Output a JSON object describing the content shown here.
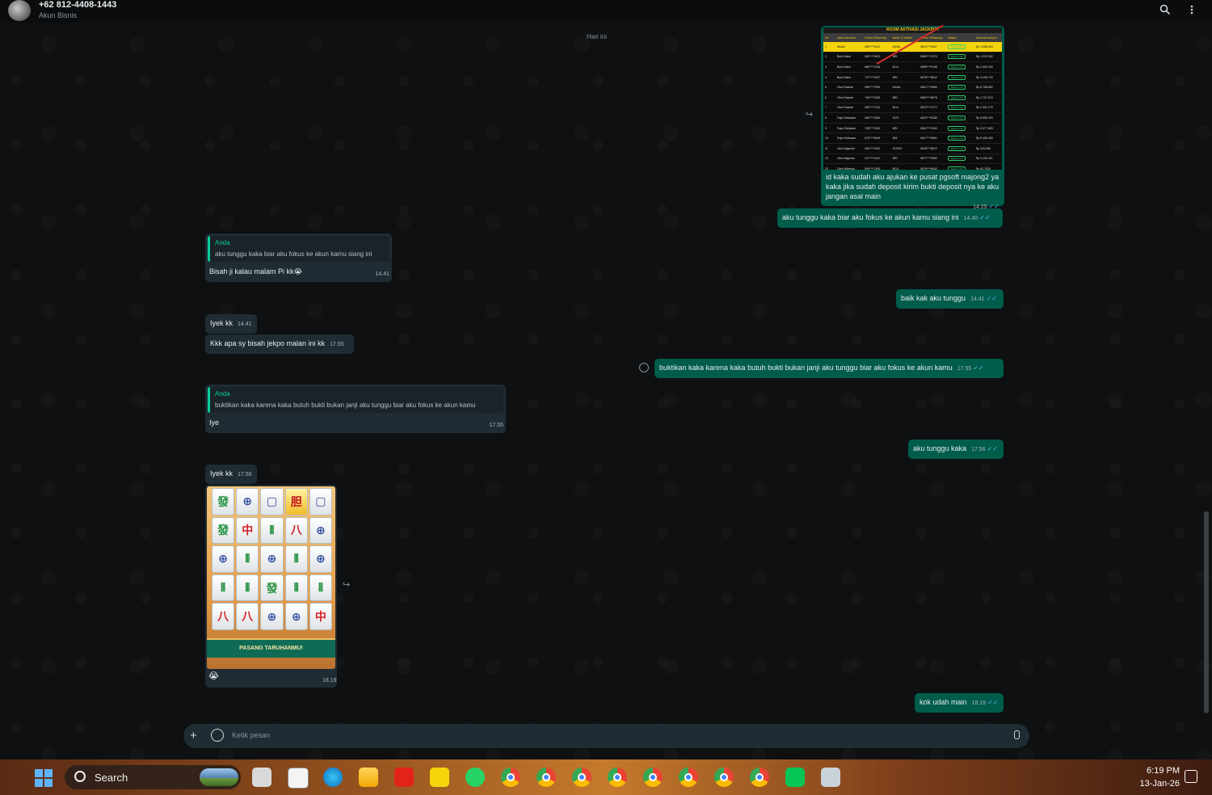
{
  "header": {
    "contact_name": "+62 812-4408-1443",
    "contact_sub": "Akun Bisnis",
    "icons": [
      "search-icon",
      "more-vert-icon"
    ]
  },
  "chat": {
    "day_label": "Hari ini",
    "messages": [
      {
        "id": "m1",
        "side": "out",
        "text": "id kaka sudah aku ajukan ke pusat pgsoft majong2 ya kaka jika sudah deposit kirim bukti deposit nya ke aku jangan asal main",
        "time": "14.25"
      },
      {
        "id": "m2",
        "side": "out",
        "text": "aku tunggu kaka biar aku fokus ke akun kamu siang ini",
        "time": "14.40"
      },
      {
        "id": "m3",
        "side": "in",
        "quote_author": "Anda",
        "quote_text": "aku tunggu kaka biar aku fokus ke akun kamu siang ini",
        "text": "Bisah ji kalau malam Pi kk😭",
        "time": "14.41"
      },
      {
        "id": "m4",
        "side": "out",
        "text": "baik kak aku tunggu",
        "time": "14.41"
      },
      {
        "id": "m5",
        "side": "in",
        "text": "Iyek kk",
        "time": "14.41"
      },
      {
        "id": "m6",
        "side": "in",
        "text": "Kkk apa sy bisah jekpo malan ini kk",
        "time": "17.55"
      },
      {
        "id": "m7",
        "side": "out",
        "text": "buktikan kaka karena kaka butuh bukti bukan janji aku tunggu biar aku fokus ke akun kamu",
        "time": "17.55"
      },
      {
        "id": "m8",
        "side": "in",
        "quote_author": "Anda",
        "quote_text": "buktikan kaka karena kaka butuh bukti bukan janji aku tunggu biar aku fokus ke akun kamu",
        "text": "Iye",
        "time": "17.55"
      },
      {
        "id": "m9",
        "side": "out",
        "text": "aku tunggu kaka",
        "time": "17.56"
      },
      {
        "id": "m10",
        "side": "in",
        "text": "Iyek kk",
        "time": "17.56"
      },
      {
        "id": "m11",
        "side": "in",
        "text": "😭",
        "time": "18.19",
        "image_caption": "PASANG TARUHANMU!"
      },
      {
        "id": "m12",
        "side": "out",
        "text": "kok udah main",
        "time": "18.19"
      }
    ],
    "ticks_glyph": "✓✓",
    "forward_glyph": "↪"
  },
  "table_image": {
    "title": "ROOM AKTIVASI JACKPOT",
    "headers": [
      "No",
      "Nama Member",
      "Nomor Rekening",
      "Bank / E-Wallet",
      "Nomor WhatsApp",
      "Status",
      "Nominal Jackpot"
    ],
    "rows": [
      [
        "1",
        "Wulan",
        "056****4412",
        "DANA",
        "0813****5447",
        "Jackpot OK",
        "Rp 1.058.000"
      ],
      [
        "2",
        "Budi Halim",
        "082****0521",
        "BRI",
        "0853****2270",
        "Jackpot OK",
        "Rp 1.222.352"
      ],
      [
        "3",
        "Budi Halim",
        "689****2136",
        "BCA",
        "0856****9198",
        "Jackpot OK",
        "Rp 2.095.049"
      ],
      [
        "4",
        "Budi Halim",
        "727****3227",
        "BRI",
        "0878****8812",
        "Jackpot OK",
        "Rp 3.208.722"
      ],
      [
        "5",
        "Citra Rasmie",
        "059****7992",
        "DANA",
        "0821****5080",
        "Jackpot OK",
        "Rp 8.758.892"
      ],
      [
        "6",
        "Citra Rasmie",
        "740****2152",
        "BRI",
        "0852****8978",
        "Jackpot OK",
        "Rp 2.707.674"
      ],
      [
        "7",
        "Citra Rasmie",
        "490****7114",
        "BCA",
        "0812****4771",
        "Jackpot OK",
        "Rp 2.391.175"
      ],
      [
        "8",
        "Fajar Setiawan",
        "083****1840",
        "OVO",
        "0822****8180",
        "Jackpot OK",
        "Rp 8.955.429"
      ],
      [
        "9",
        "Fajar Setiawan",
        "738****3130",
        "BRI",
        "0811****1290",
        "Jackpot OK",
        "Rp 5.377.889"
      ],
      [
        "10",
        "Fajar Setiawan",
        "670****5409",
        "BNI",
        "0817****6651",
        "Jackpot OK",
        "Rp 5.498.208"
      ],
      [
        "11",
        "Citra Wigendo",
        "054****2240",
        "GOPAY",
        "0818****8672",
        "Jackpot OK",
        "Rp 315.008"
      ],
      [
        "12",
        "Citra Wigendo",
        "217****4410",
        "BRI",
        "0877****9952",
        "Jackpot OK",
        "Rp 9.239.201"
      ],
      [
        "13",
        "Citra Wigendo",
        "599****7483",
        "BCA",
        "0878****8442",
        "Jackpot OK",
        "Rp 617.803"
      ]
    ]
  },
  "game_image": {
    "button_label": "PASANG TARUHANMU!",
    "tiles": [
      "發",
      "⊕",
      "▢",
      "胆",
      "▢",
      "發",
      "中",
      "⦀",
      "八",
      "⊕",
      "⊕",
      "⦀",
      "⊕",
      "⦀",
      "⊕",
      "⦀",
      "⦀",
      "發",
      "⦀",
      "⦀",
      "八",
      "八",
      "⊕",
      "⊕",
      "中"
    ]
  },
  "composer": {
    "placeholder": "Ketik pesan",
    "plus_glyph": "+"
  },
  "taskbar": {
    "search_label": "Search",
    "clock_time": "6:19 PM",
    "clock_date": "13-Jan-26",
    "apps": [
      "task-view-icon",
      "notepad-icon",
      "edge-icon",
      "file-explorer-icon",
      "wps-office-icon",
      "sticky-notes-icon",
      "whatsapp-icon",
      "chrome-icon",
      "chrome-icon",
      "chrome-icon",
      "chrome-icon",
      "chrome-icon",
      "chrome-icon",
      "chrome-icon",
      "chrome-icon",
      "line-icon",
      "app-icon"
    ]
  }
}
